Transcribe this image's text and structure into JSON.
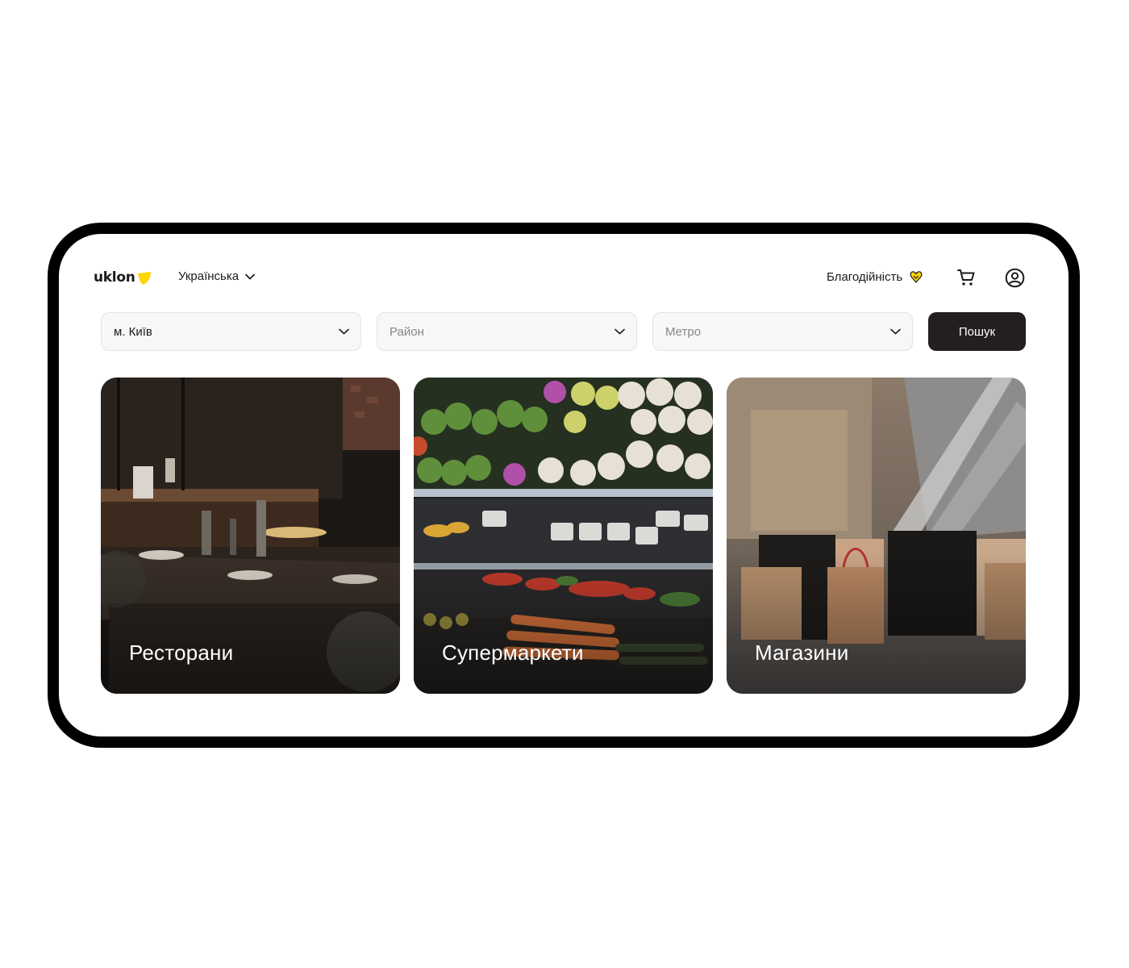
{
  "brand": {
    "name": "uklon",
    "accent": "#ffd400"
  },
  "header": {
    "language": "Українська",
    "charity": "Благодійність",
    "icons": [
      "chevron-down-icon",
      "hearts-icon",
      "cart-icon",
      "profile-icon"
    ]
  },
  "filters": {
    "city": {
      "value": "м. Київ"
    },
    "district": {
      "placeholder": "Район"
    },
    "metro": {
      "placeholder": "Метро"
    },
    "search_label": "Пошук"
  },
  "categories": [
    {
      "label": "Ресторани"
    },
    {
      "label": "Супермаркети"
    },
    {
      "label": "Магазини"
    }
  ],
  "colors": {
    "dark_button": "#231f1e",
    "input_bg": "#f7f7f8",
    "device_frame": "#000000"
  }
}
